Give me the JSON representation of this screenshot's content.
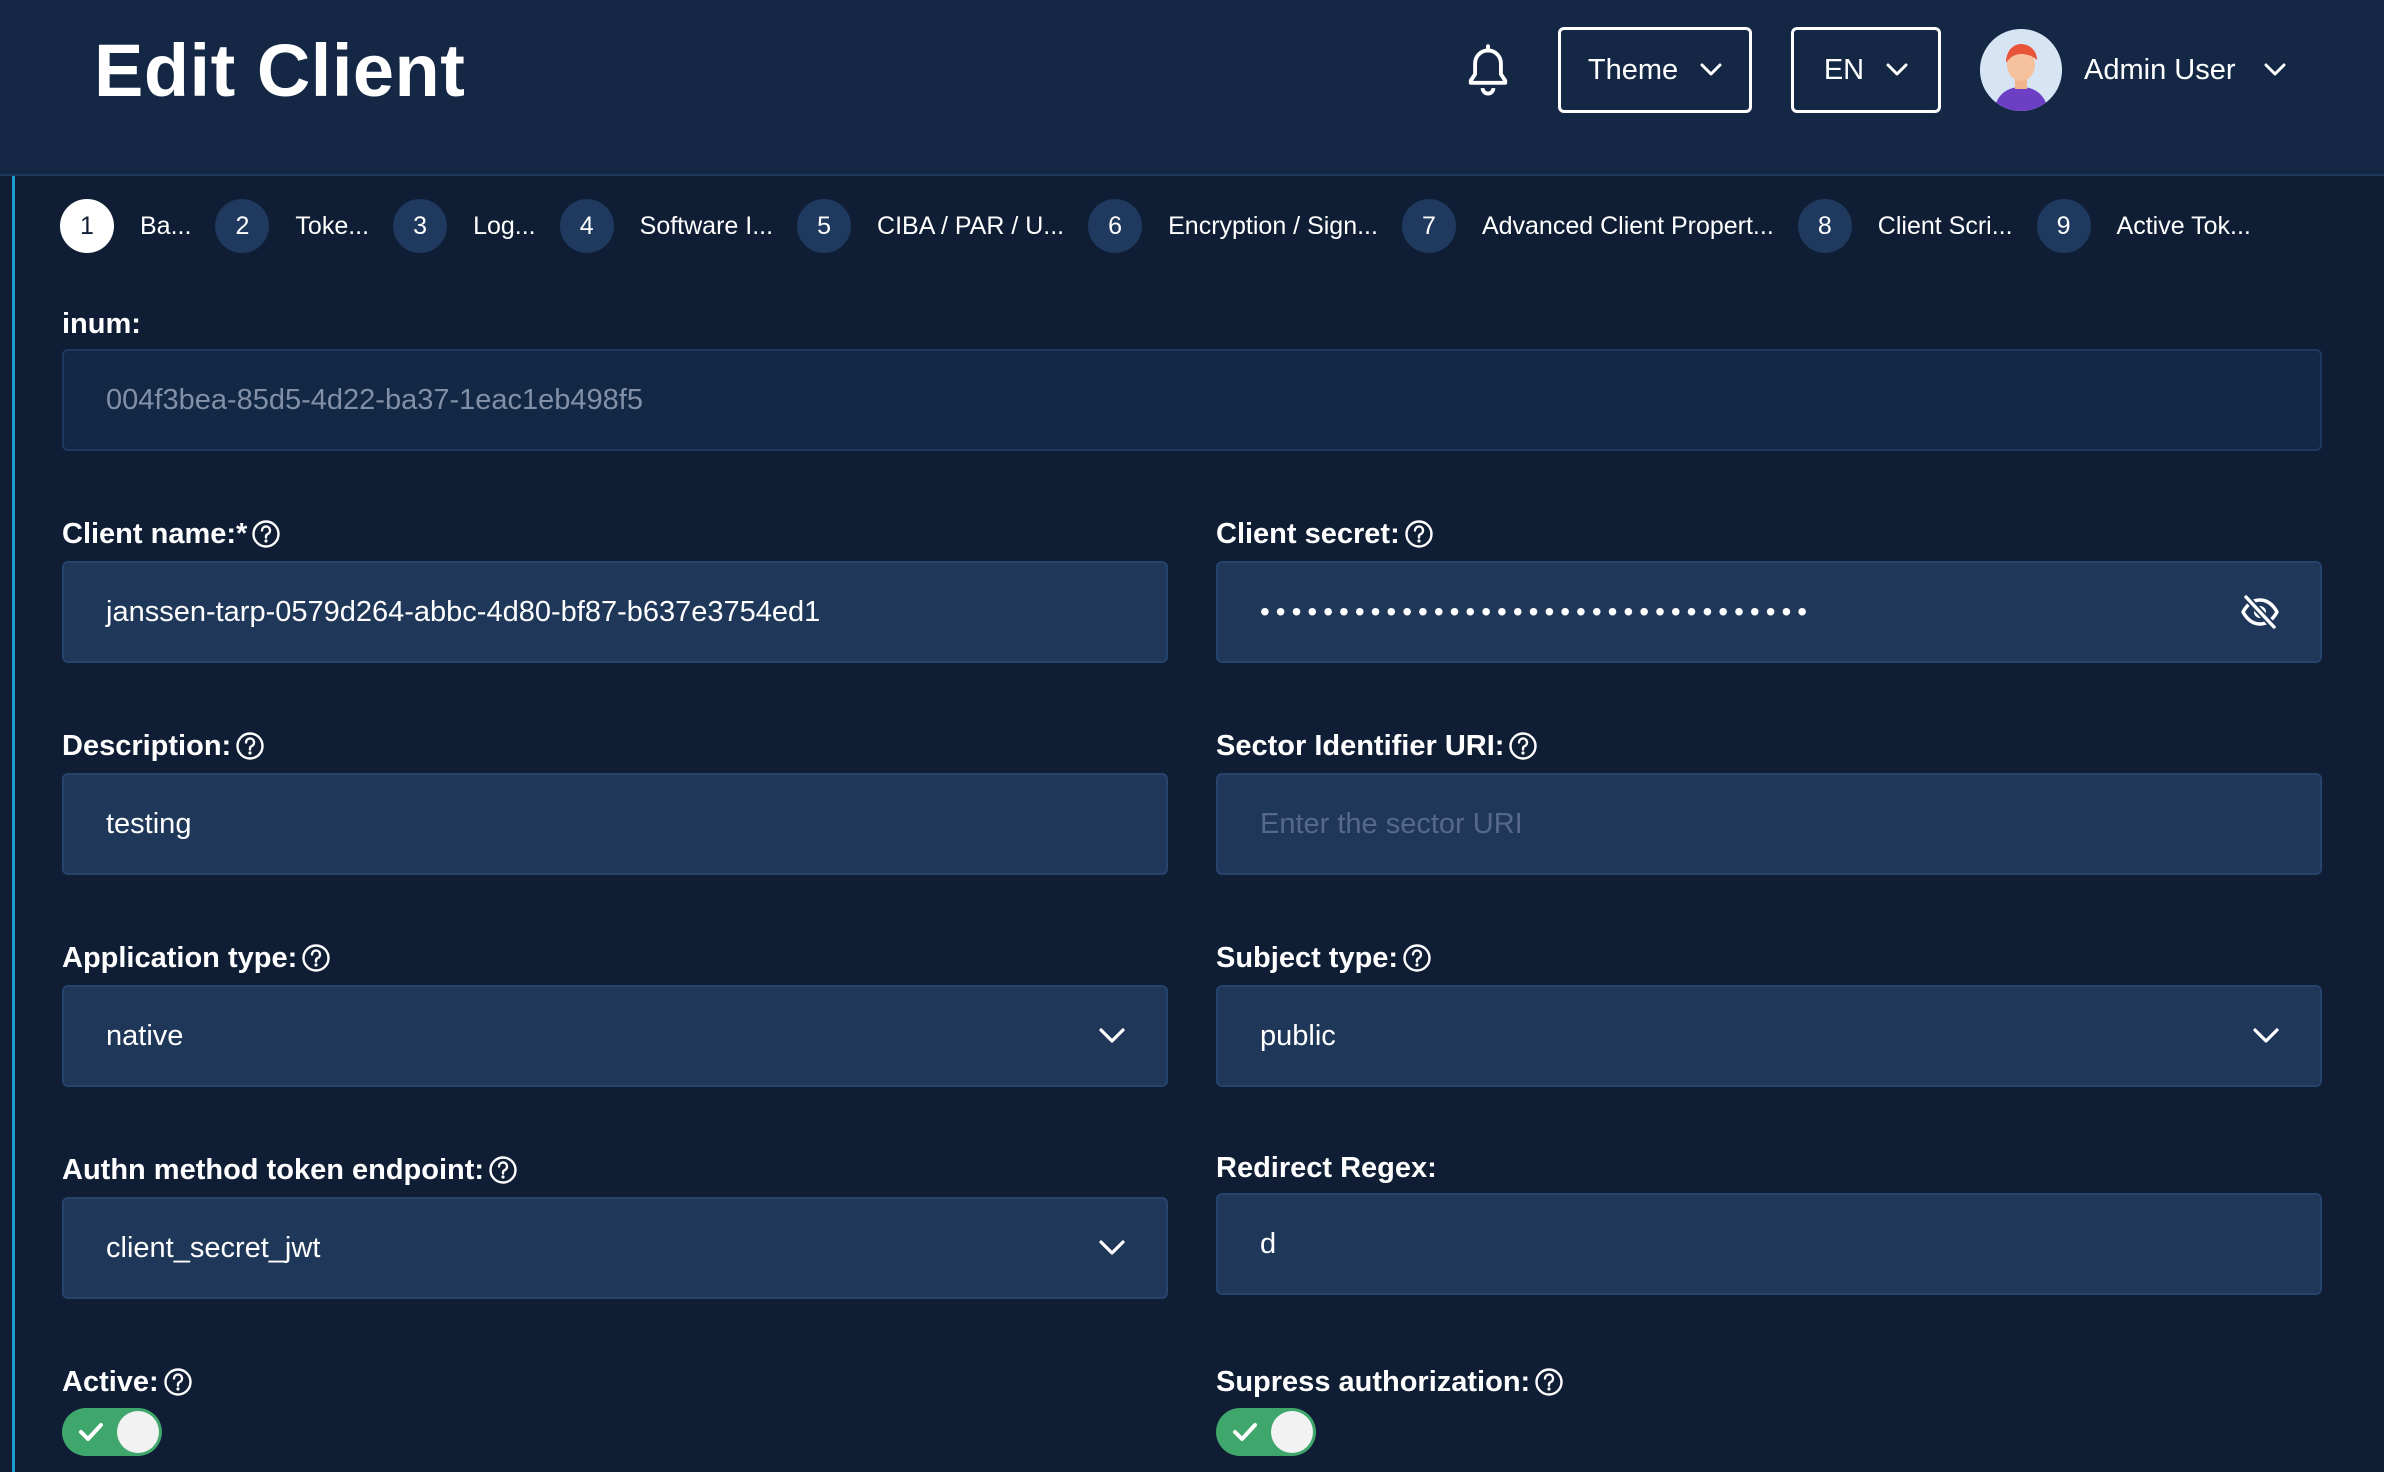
{
  "header": {
    "title": "Edit Client",
    "theme_label": "Theme",
    "lang_label": "EN",
    "user_name": "Admin User"
  },
  "stepper": {
    "steps": [
      {
        "num": "1",
        "label": "Ba..."
      },
      {
        "num": "2",
        "label": "Toke..."
      },
      {
        "num": "3",
        "label": "Log..."
      },
      {
        "num": "4",
        "label": "Software I..."
      },
      {
        "num": "5",
        "label": "CIBA / PAR / U..."
      },
      {
        "num": "6",
        "label": "Encryption / Sign..."
      },
      {
        "num": "7",
        "label": "Advanced Client Propert..."
      },
      {
        "num": "8",
        "label": "Client Scri..."
      },
      {
        "num": "9",
        "label": "Active Tok..."
      }
    ],
    "active_step": 1
  },
  "form": {
    "inum": {
      "label": "inum:",
      "value": "004f3bea-85d5-4d22-ba37-1eac1eb498f5"
    },
    "client_name": {
      "label": "Client name:*",
      "value": "janssen-tarp-0579d264-abbc-4d80-bf87-b637e3754ed1"
    },
    "client_secret": {
      "label": "Client secret:",
      "value": "•••••••••••••••••••••••••••••••••••"
    },
    "description": {
      "label": "Description:",
      "value": "testing"
    },
    "sector_uri": {
      "label": "Sector Identifier URI:",
      "placeholder": "Enter the sector URI"
    },
    "application_type": {
      "label": "Application type:",
      "value": "native"
    },
    "subject_type": {
      "label": "Subject type:",
      "value": "public"
    },
    "authn_method": {
      "label": "Authn method token endpoint:",
      "value": "client_secret_jwt"
    },
    "redirect_regex": {
      "label": "Redirect Regex:",
      "value": "d"
    },
    "active": {
      "label": "Active:",
      "on": true
    },
    "suppress_authorization": {
      "label": "Supress authorization:",
      "on": true
    }
  },
  "colors": {
    "background": "#0f1e35",
    "header": "#142846",
    "field": "#1f3759",
    "toggle_on": "#3fa76b",
    "accent_border": "#1d9bd1"
  },
  "icons": [
    "bell-icon",
    "chevron-down-icon",
    "help-icon",
    "eye-off-icon",
    "check-icon"
  ]
}
